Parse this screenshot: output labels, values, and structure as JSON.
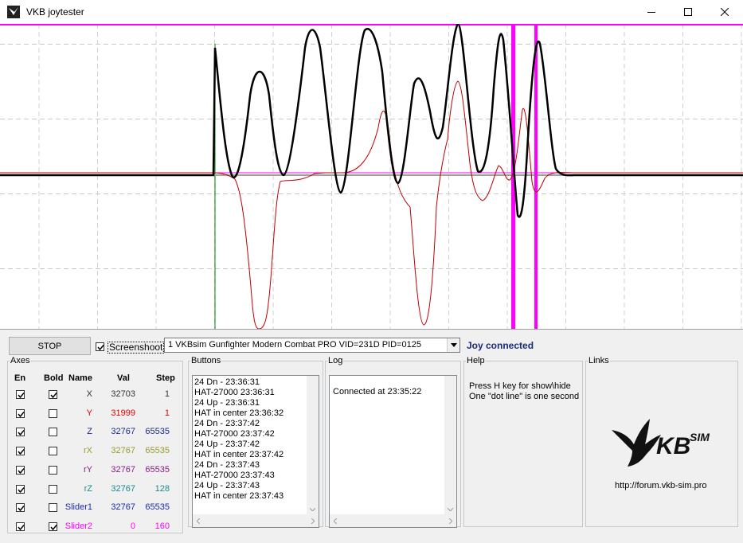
{
  "window": {
    "title": "VKB joytester"
  },
  "icons": {
    "app": "vkb-eagle-icon",
    "minimize": "minimize-icon",
    "maximize": "maximize-icon",
    "close": "close-icon"
  },
  "colors": {
    "trace_black": "#000000",
    "trace_red": "#c00000",
    "trace_magenta": "#ff00ff",
    "trace_green": "#008000",
    "status": "#1a2a7a"
  },
  "toolbar": {
    "stop_label": "STOP",
    "screenshot_label": "Screenshoot",
    "screenshot_checked": true,
    "device_selected": "1 VKBsim Gunfighter Modern Combat PRO  VID=231D PID=0125",
    "status": "Joy connected"
  },
  "axes": {
    "legend": "Axes",
    "headers": {
      "en": "En",
      "bold": "Bold",
      "name": "Name",
      "val": "Val",
      "step": "Step"
    },
    "rows": [
      {
        "name": "X",
        "val": "32703",
        "step": "1",
        "en": true,
        "bold": true,
        "color": "#333333"
      },
      {
        "name": "Y",
        "val": "31999",
        "step": "1",
        "en": true,
        "bold": false,
        "color": "#e00000"
      },
      {
        "name": "Z",
        "val": "32767",
        "step": "65535",
        "en": true,
        "bold": false,
        "color": "#1a2a8a"
      },
      {
        "name": "rX",
        "val": "32767",
        "step": "65535",
        "en": true,
        "bold": false,
        "color": "#9a9a30"
      },
      {
        "name": "rY",
        "val": "32767",
        "step": "65535",
        "en": true,
        "bold": false,
        "color": "#8a1a8a"
      },
      {
        "name": "rZ",
        "val": "32767",
        "step": "128",
        "en": true,
        "bold": false,
        "color": "#1a8a8a"
      },
      {
        "name": "Slider1",
        "val": "32767",
        "step": "65535",
        "en": true,
        "bold": false,
        "color": "#1a2ab0"
      },
      {
        "name": "Slider2",
        "val": "0",
        "step": "160",
        "en": true,
        "bold": true,
        "color": "#ff00ff"
      }
    ]
  },
  "buttons_panel": {
    "legend": "Buttons",
    "lines": [
      "24 Dn - 23:36:31",
      "HAT-27000 23:36:31",
      "24 Up - 23:36:31",
      "HAT in center 23:36:32",
      "24 Dn - 23:37:42",
      "HAT-27000 23:37:42",
      "24 Up - 23:37:42",
      "HAT in center 23:37:42",
      "24 Dn - 23:37:43",
      "HAT-27000 23:37:43",
      "24 Up - 23:37:43",
      "HAT in center 23:37:43"
    ]
  },
  "log_panel": {
    "legend": "Log",
    "lines": [
      "Connected at 23:35:22"
    ]
  },
  "help_panel": {
    "legend": "Help",
    "lines": [
      "Press H key for show\\hide",
      "One \"dot line\" is one second"
    ]
  },
  "links_panel": {
    "legend": "Links",
    "logo_text": "KBSIM",
    "url": "http://forum.vkb-sim.pro"
  }
}
